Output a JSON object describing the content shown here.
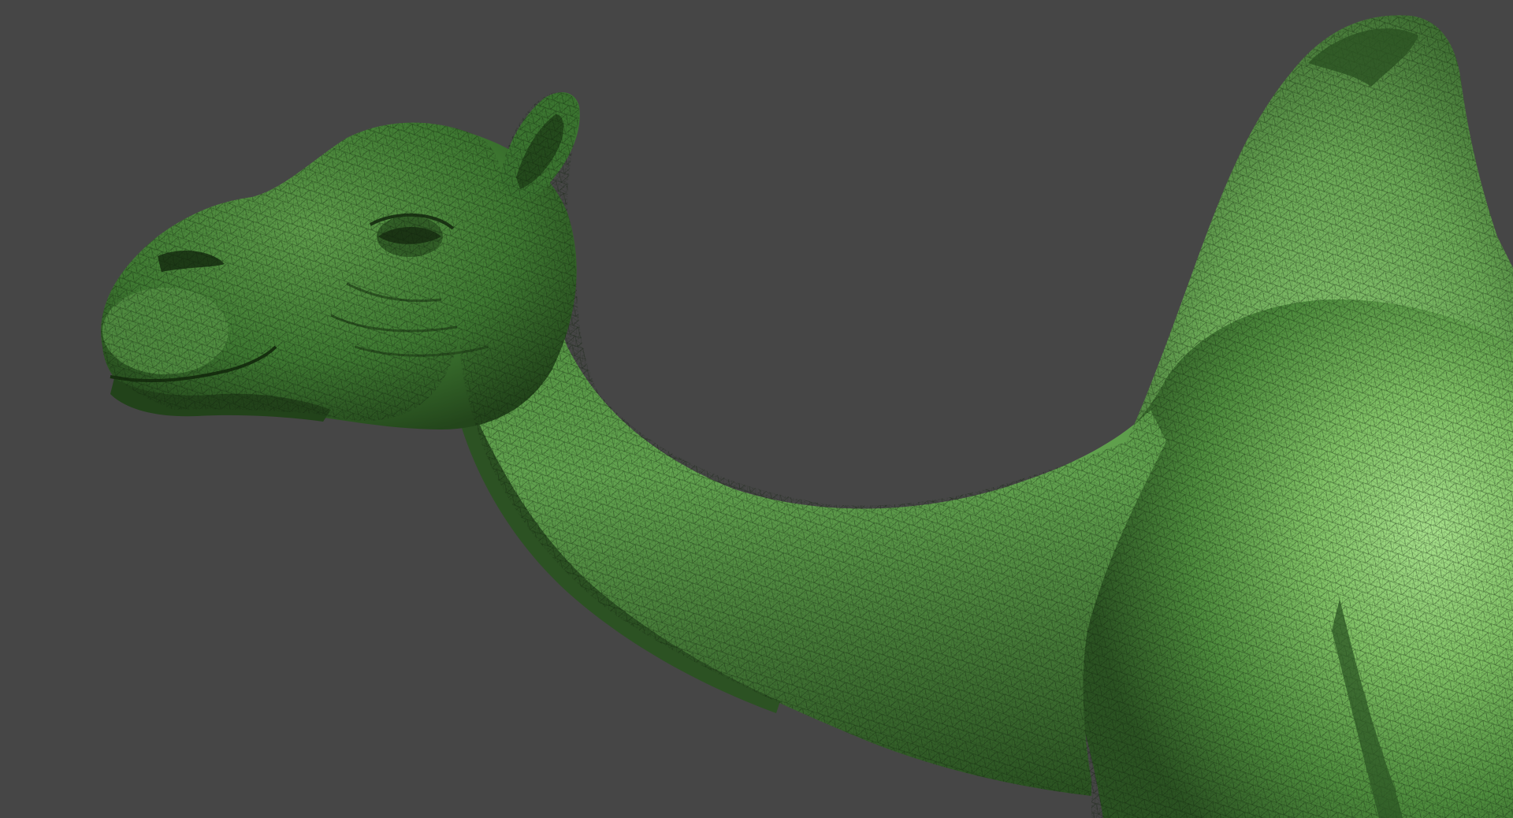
{
  "viewport": {
    "background_color": "#464646",
    "subject": "camel-sculpt-mesh",
    "mesh_colors": {
      "highlight": "#9bd880",
      "mid": "#6aa855",
      "base": "#3f7a32",
      "shadow": "#1f3d17",
      "wire": "#0e1f0a"
    }
  }
}
